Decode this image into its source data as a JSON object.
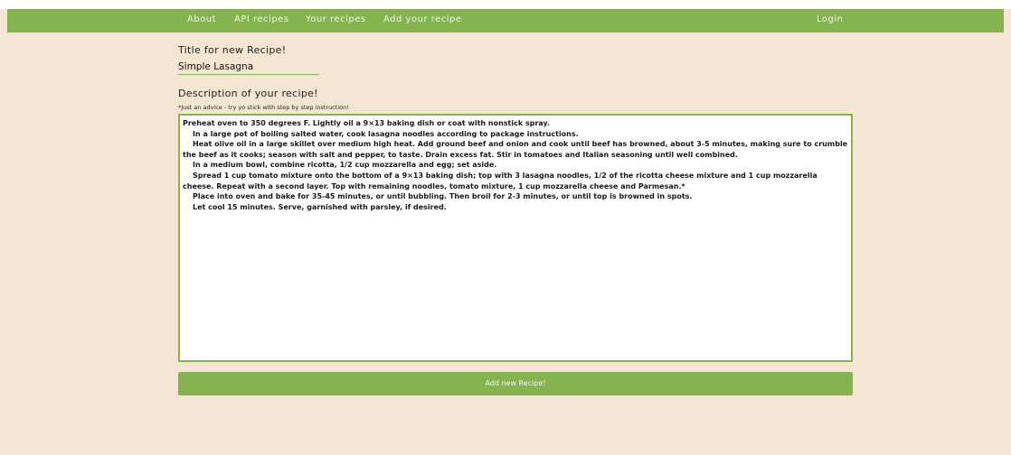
{
  "nav": {
    "about": "About",
    "api_recipes": "API recipes",
    "your_recipes": "Your recipes",
    "add_recipe": "Add your recipe",
    "login": "Login"
  },
  "form": {
    "title_label": "Title for new Recipe!",
    "title_value": "Simple Lasagna",
    "description_label": "Description of your recipe!",
    "advice": "*Just an advice - try yo stick with step by step instruction!",
    "description_lines": [
      "Preheat oven to 350 degrees F. Lightly oil a 9×13 baking dish or coat with nonstick spray.",
      "In a large pot of boiling salted water, cook lasagna noodles according to package instructions.",
      "Heat olive oil in a large skillet over medium high heat. Add ground beef and onion and cook until beef has browned, about 3-5 minutes, making sure to crumble the beef as it cooks; season with salt and pepper, to taste. Drain excess fat. Stir in tomatoes and Italian seasoning until well combined.",
      "In a medium bowl, combine ricotta, 1/2 cup mozzarella and egg; set aside.",
      "Spread 1 cup tomato mixture onto the bottom of a 9×13 baking dish; top with 3 lasagna noodles, 1/2 of the ricotta cheese mixture and 1 cup mozzarella cheese. Repeat with a second layer. Top with remaining noodles, tomato mixture, 1 cup mozzarella cheese and Parmesan.*",
      "Place into oven and bake for 35-45 minutes, or until bubbling. Then broil for 2-3 minutes, or until top is browned in spots.",
      "Let cool 15 minutes. Serve, garnished with parsley, if desired."
    ],
    "submit_label": "Add new Recipe!"
  },
  "colors": {
    "accent": "#84b34f",
    "background": "#f5e6d3"
  }
}
